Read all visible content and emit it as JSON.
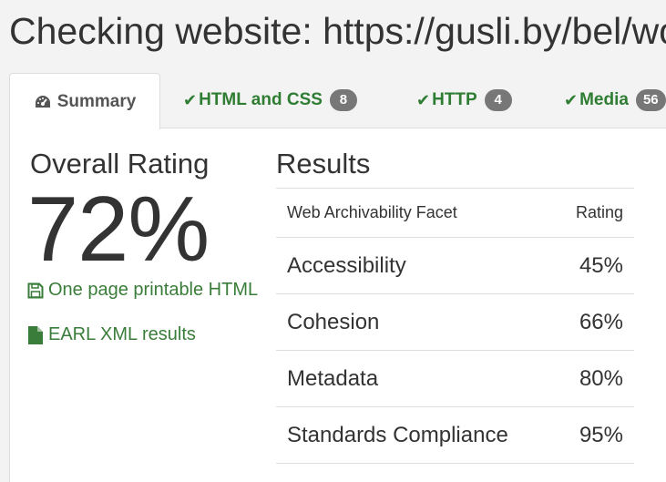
{
  "page_title": "Checking website: https://gusli.by/bel/wor",
  "tabs": [
    {
      "label": "Summary",
      "icon": "dashboard-icon",
      "active": true
    },
    {
      "label": "HTML and CSS",
      "icon": "check-icon",
      "badge": "8"
    },
    {
      "label": "HTTP",
      "icon": "check-icon",
      "badge": "4"
    },
    {
      "label": "Media",
      "icon": "check-icon",
      "badge": "56"
    }
  ],
  "overall": {
    "label": "Overall Rating",
    "value": "72%"
  },
  "links": {
    "printable": "One page printable HTML",
    "earl": "EARL XML results"
  },
  "results": {
    "title": "Results",
    "col_facet": "Web Archivability Facet",
    "col_rating": "Rating",
    "rows": [
      {
        "facet": "Accessibility",
        "rating": "45%"
      },
      {
        "facet": "Cohesion",
        "rating": "66%"
      },
      {
        "facet": "Metadata",
        "rating": "80%"
      },
      {
        "facet": "Standards Compliance",
        "rating": "95%"
      }
    ]
  },
  "colors": {
    "green": "#2e7d32",
    "link_green": "#3a7d3a",
    "badge_gray": "#777777"
  }
}
